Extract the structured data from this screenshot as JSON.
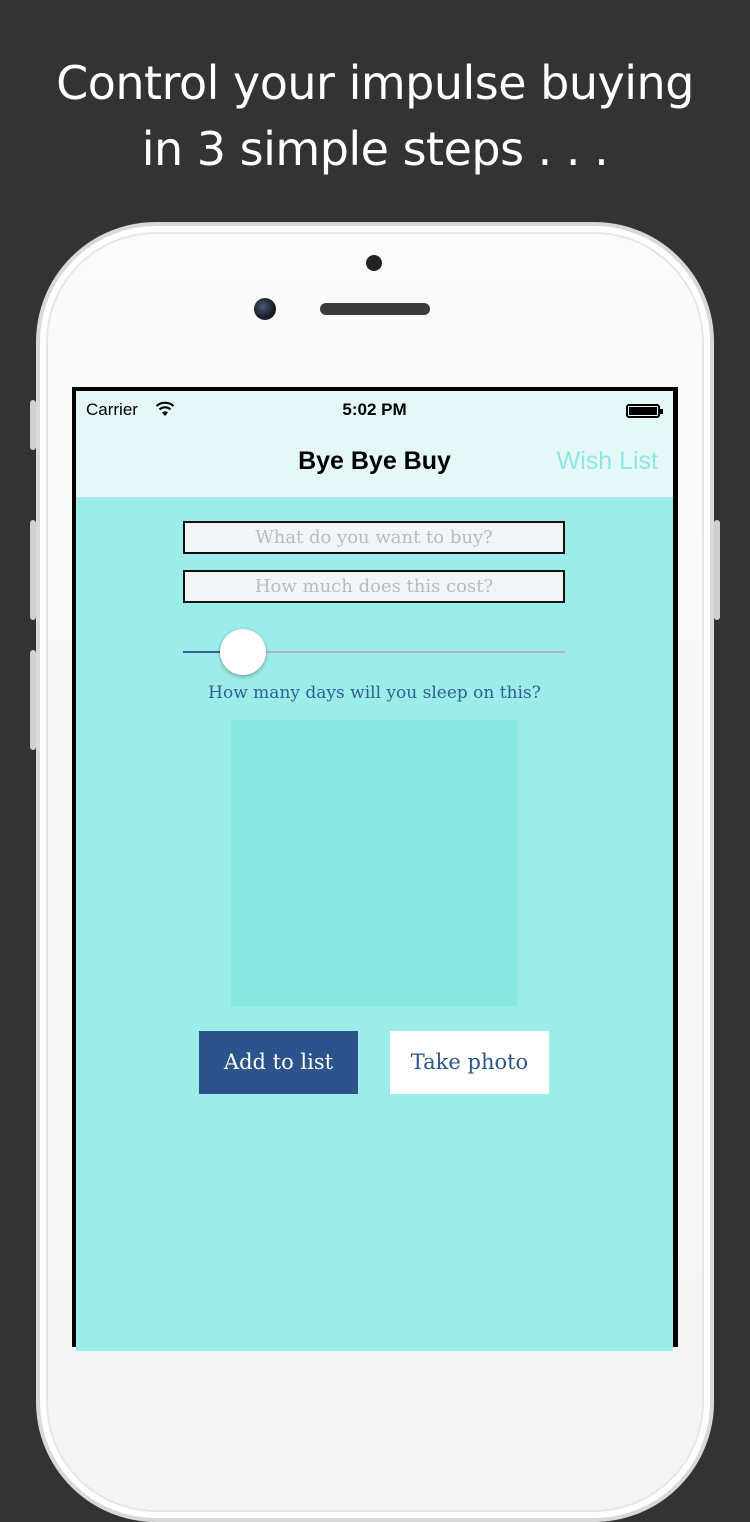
{
  "headline": {
    "line1": "Control your impulse buying",
    "line2": "in 3 simple steps . . ."
  },
  "status_bar": {
    "carrier": "Carrier",
    "time": "5:02 PM",
    "wifi_icon": "wifi-icon",
    "battery_icon": "battery-icon"
  },
  "nav": {
    "title": "Bye Bye Buy",
    "wish_list": "Wish List"
  },
  "form": {
    "item_placeholder": "What do you want to buy?",
    "item_value": "",
    "cost_placeholder": "How much does this cost?",
    "cost_value": "",
    "slider_label": "How many days will you sleep on this?",
    "slider_value_fraction": 0.15
  },
  "buttons": {
    "add_to_list": "Add to list",
    "take_photo": "Take photo"
  },
  "colors": {
    "background": "#333333",
    "screen": "#9cecea",
    "nav_bar": "#e4f8f7",
    "accent": "#2c538c",
    "wish_list": "#8fe6e3",
    "photo_area": "#87e8e2"
  }
}
